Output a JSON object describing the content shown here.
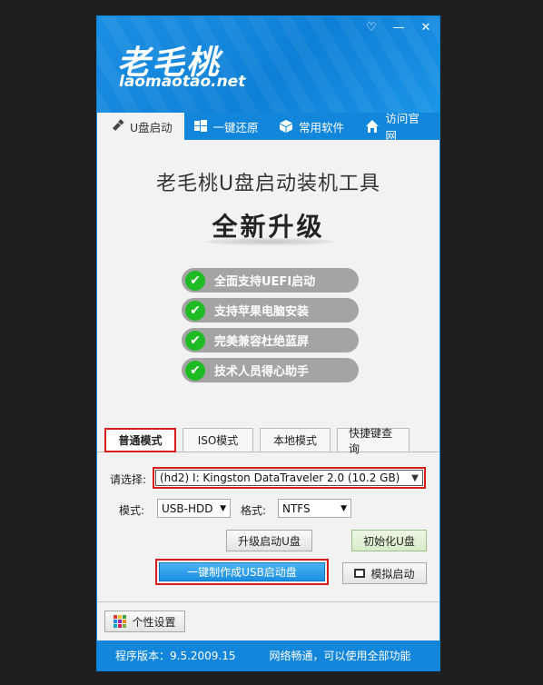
{
  "header": {
    "logo_main": "老毛桃",
    "logo_sub": "laomaotao.net",
    "controls": [
      "♡",
      "—",
      "✕"
    ]
  },
  "tabs": [
    {
      "label": "U盘启动",
      "icon": "usb-icon"
    },
    {
      "label": "一键还原",
      "icon": "windows-icon"
    },
    {
      "label": "常用软件",
      "icon": "box-icon"
    },
    {
      "label": "访问官网",
      "icon": "home-icon"
    }
  ],
  "hero": {
    "title": "老毛桃U盘启动装机工具",
    "subtitle": "全新升级",
    "features": [
      "全面支持UEFI启动",
      "支持苹果电脑安装",
      "完美兼容杜绝蓝屏",
      "技术人员得心助手"
    ]
  },
  "modes": [
    "普通模式",
    "ISO模式",
    "本地模式",
    "快捷键查询"
  ],
  "form": {
    "device_label": "请选择:",
    "device_value": "(hd2) I: Kingston DataTraveler 2.0 (10.2 GB)",
    "mode_label": "模式:",
    "mode_value": "USB-HDD",
    "format_label": "格式:",
    "format_value": "NTFS"
  },
  "buttons": {
    "upgrade": "升级启动U盘",
    "init": "初始化U盘",
    "make": "一键制作成USB启动盘",
    "simulate": "模拟启动",
    "personalize": "个性设置"
  },
  "footer": {
    "version": "程序版本：9.5.2009.15",
    "network": "网络畅通，可以使用全部功能"
  },
  "colors": {
    "accent": "#1186da",
    "highlight": "#d81d1d",
    "check": "#1fbb24"
  }
}
